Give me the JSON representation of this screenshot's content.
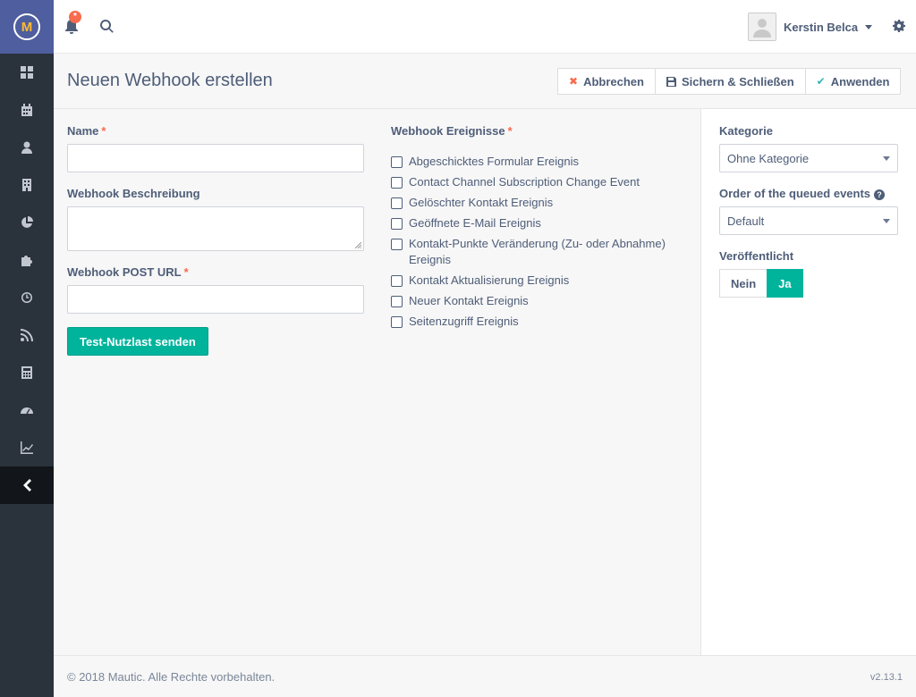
{
  "sidebar": {
    "logo": "M",
    "items": [
      {
        "icon": "dashboard-icon"
      },
      {
        "icon": "calendar-icon"
      },
      {
        "icon": "user-icon"
      },
      {
        "icon": "building-icon"
      },
      {
        "icon": "pie-chart-icon"
      },
      {
        "icon": "puzzle-icon"
      },
      {
        "icon": "clock-icon"
      },
      {
        "icon": "rss-icon"
      },
      {
        "icon": "calculator-icon"
      },
      {
        "icon": "gauge-icon"
      },
      {
        "icon": "line-chart-icon"
      }
    ],
    "collapse_icon": "chevron-left-icon"
  },
  "topbar": {
    "notification_badge": "*",
    "user_name": "Kerstin Belca"
  },
  "header": {
    "title": "Neuen Webhook erstellen",
    "cancel_label": "Abbrechen",
    "save_close_label": "Sichern & Schließen",
    "apply_label": "Anwenden"
  },
  "form": {
    "name_label": "Name",
    "name_value": "",
    "description_label": "Webhook Beschreibung",
    "description_value": "",
    "url_label": "Webhook POST URL",
    "url_value": "",
    "required_mark": "*",
    "test_button": "Test-Nutzlast senden",
    "events_label": "Webhook Ereignisse",
    "events": [
      "Abgeschicktes Formular Ereignis",
      "Contact Channel Subscription Change Event",
      "Gelöschter Kontakt Ereignis",
      "Geöffnete E-Mail Ereignis",
      "Kontakt-Punkte Veränderung (Zu- oder Abnahme) Ereignis",
      "Kontakt Aktualisierung Ereignis",
      "Neuer Kontakt Ereignis",
      "Seitenzugriff Ereignis"
    ]
  },
  "side": {
    "category_label": "Kategorie",
    "category_value": "Ohne Kategorie",
    "order_label": "Order of the queued events",
    "order_value": "Default",
    "help_glyph": "?",
    "published_label": "Veröffentlicht",
    "no_label": "Nein",
    "yes_label": "Ja",
    "published_value": "Ja"
  },
  "footer": {
    "copyright": "© 2018 Mautic. Alle Rechte vorbehalten.",
    "version": "v2.13.1"
  },
  "colors": {
    "accent": "#00b49c",
    "sidebar": "#2a323c",
    "logo_bg": "#4e5e9e",
    "danger": "#f86b4f"
  }
}
